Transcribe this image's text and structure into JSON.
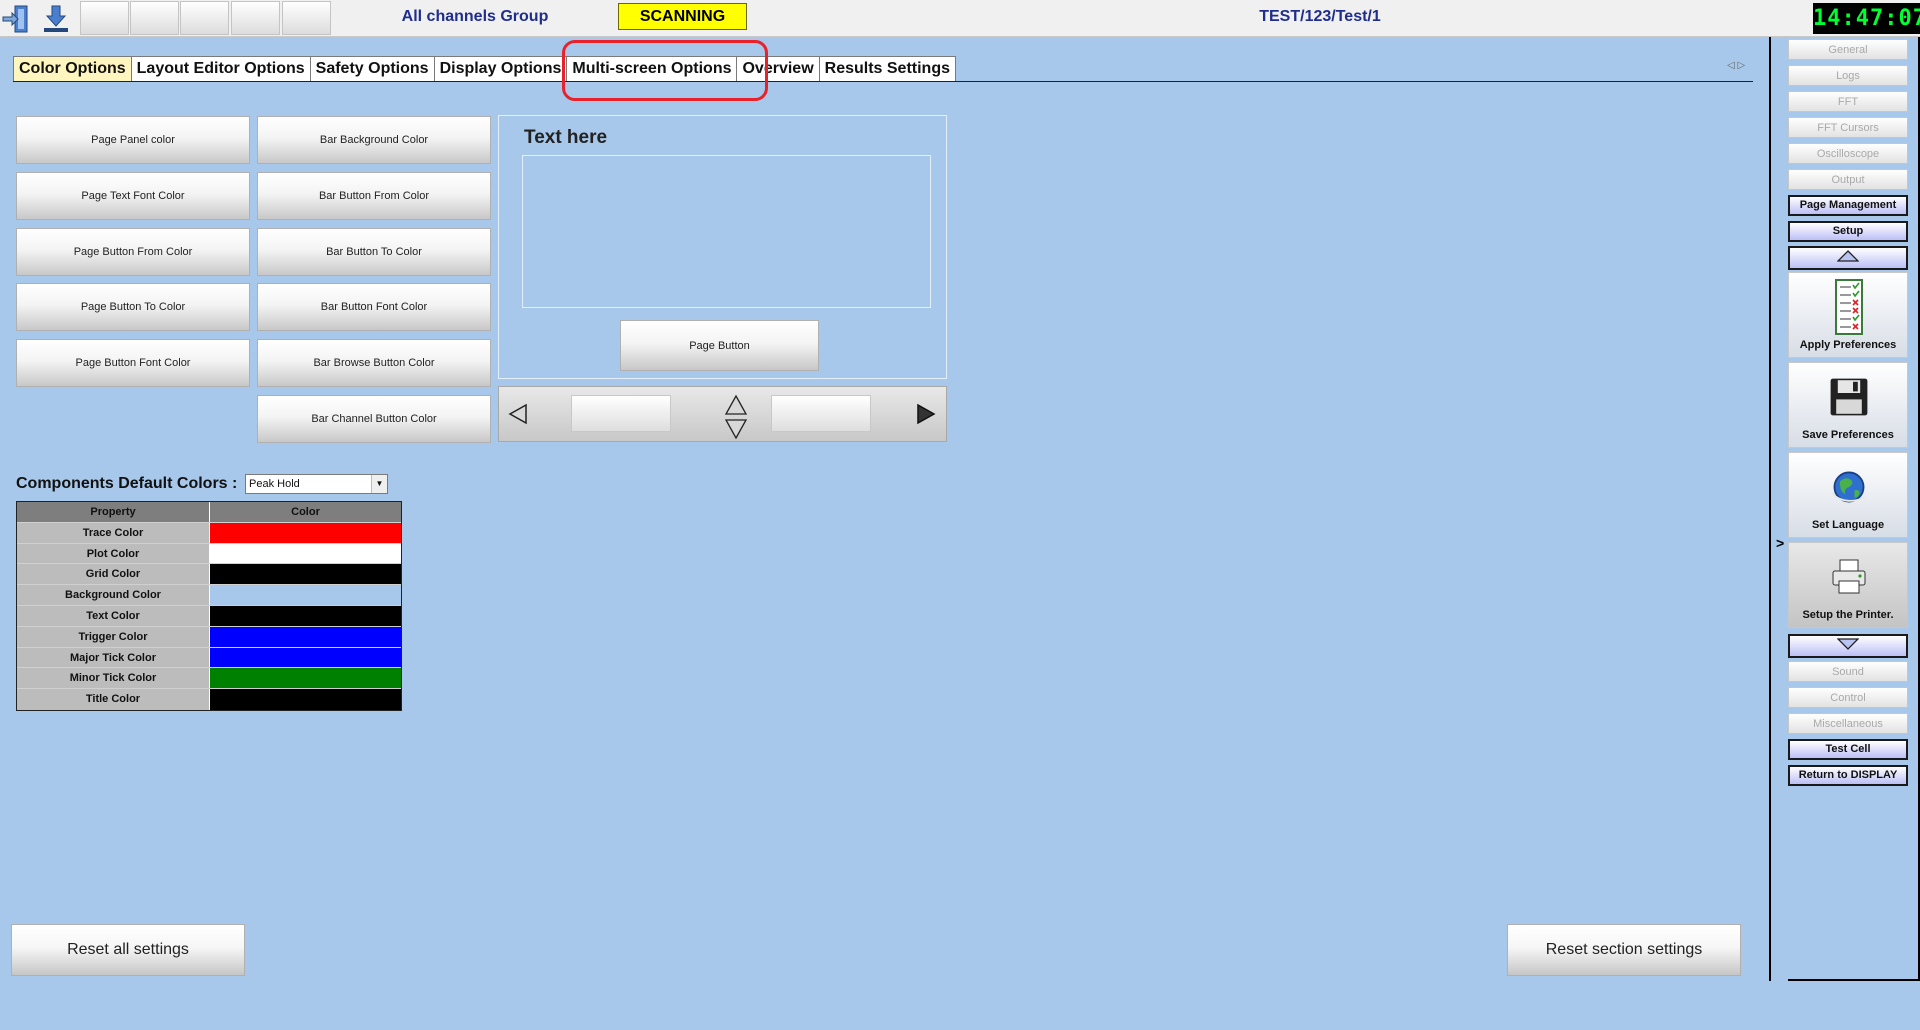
{
  "topbar": {
    "group_title": "All channels Group",
    "status": "SCANNING",
    "test_path": "TEST/123/Test/1",
    "clock": "14:47:07",
    "icons": [
      "exit-icon",
      "download-icon"
    ]
  },
  "tabs": [
    {
      "label": "Color Options",
      "active": true
    },
    {
      "label": "Layout Editor Options",
      "active": false
    },
    {
      "label": "Safety Options",
      "active": false
    },
    {
      "label": "Display Options",
      "active": false
    },
    {
      "label": "Multi-screen Options",
      "active": false
    },
    {
      "label": "Overview",
      "active": false
    },
    {
      "label": "Results Settings",
      "active": false
    }
  ],
  "tab_scroll": "◁ ▷",
  "page_buttons": [
    "Page Panel color",
    "Page Text Font Color",
    "Page Button From Color",
    "Page Button To Color",
    "Page Button Font Color"
  ],
  "bar_buttons": [
    "Bar Background Color",
    "Bar Button From Color",
    "Bar Button To Color",
    "Bar Button Font Color",
    "Bar Browse Button Color",
    "Bar Channel Button Color"
  ],
  "preview": {
    "title": "Text here",
    "page_button": "Page Button"
  },
  "components": {
    "label": "Components Default Colors :",
    "selected": "Peak Hold",
    "headers": {
      "property": "Property",
      "color": "Color"
    },
    "rows": [
      {
        "property": "Trace Color",
        "color": "#ff0000"
      },
      {
        "property": "Plot Color",
        "color": "#ffffff"
      },
      {
        "property": "Grid Color",
        "color": "#000000"
      },
      {
        "property": "Background Color",
        "color": "#a7c8ea"
      },
      {
        "property": "Text Color",
        "color": "#000000"
      },
      {
        "property": "Trigger Color",
        "color": "#0000ff"
      },
      {
        "property": "Major Tick Color",
        "color": "#0000ff"
      },
      {
        "property": "Minor Tick Color",
        "color": "#008000"
      },
      {
        "property": "Title Color",
        "color": "#000000"
      }
    ]
  },
  "reset": {
    "all": "Reset all settings",
    "section": "Reset section settings"
  },
  "sidebar": {
    "toggle": ">",
    "top_items": [
      {
        "label": "General",
        "enabled": false
      },
      {
        "label": "Logs",
        "enabled": false
      },
      {
        "label": "FFT",
        "enabled": false
      },
      {
        "label": "FFT Cursors",
        "enabled": false
      },
      {
        "label": "Oscilloscope",
        "enabled": false
      },
      {
        "label": "Output",
        "enabled": false
      },
      {
        "label": "Page Management",
        "enabled": true
      },
      {
        "label": "Setup",
        "enabled": true
      }
    ],
    "actions": [
      {
        "label": "Apply Preferences",
        "icon": "checklist-icon"
      },
      {
        "label": "Save Preferences",
        "icon": "floppy-disk-icon"
      },
      {
        "label": "Set Language",
        "icon": "globe-icon"
      },
      {
        "label": "Setup the Printer.",
        "icon": "printer-icon"
      }
    ],
    "bottom_items": [
      {
        "label": "Sound",
        "enabled": false
      },
      {
        "label": "Control",
        "enabled": false
      },
      {
        "label": "Miscellaneous",
        "enabled": false
      },
      {
        "label": "Test Cell",
        "enabled": true
      },
      {
        "label": "Return to DISPLAY",
        "enabled": true
      }
    ]
  },
  "colors": {
    "background": "#a7c8ea",
    "status_yellow": "#ffff00",
    "clock_green": "#00ff33",
    "title_blue": "#1f2e8c",
    "highlight_red": "#e8212a"
  }
}
